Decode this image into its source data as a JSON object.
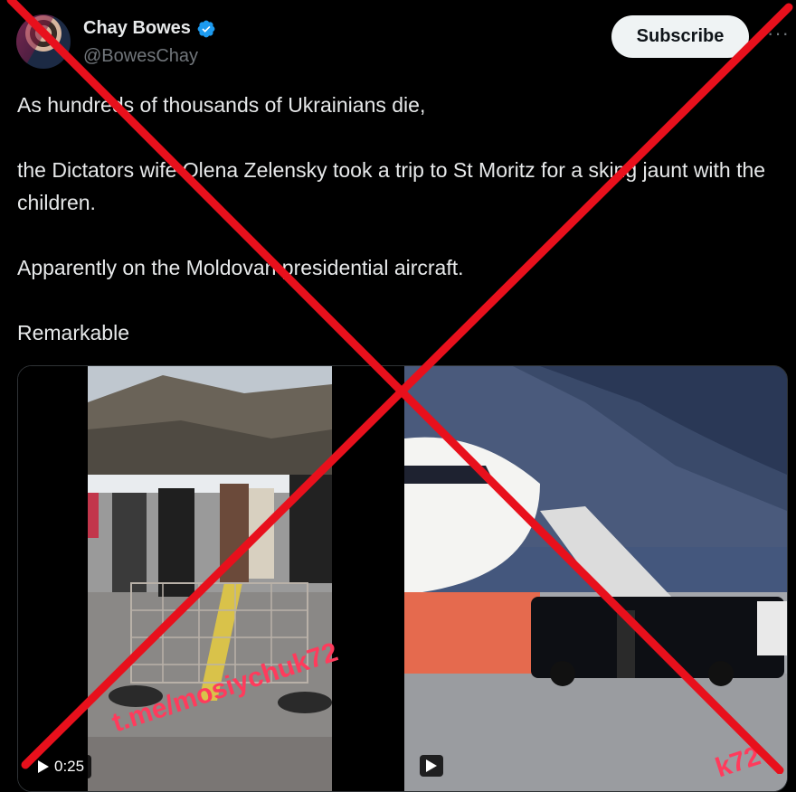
{
  "author": {
    "name": "Chay Bowes",
    "handle": "@BowesChay",
    "verified_icon": "verified-badge-icon",
    "verified_color": "#1d9bf0"
  },
  "actions": {
    "subscribe_label": "Subscribe",
    "more_label": "···"
  },
  "tweet": {
    "lines": [
      "As hundreds of thousands of Ukrainians die,",
      "the Dictators wife Olena Zelensky took a trip to St Moritz for a sking jaunt with the children.",
      "Apparently on the Moldovan presidential aircraft.",
      "Remarkable"
    ]
  },
  "media": {
    "video1": {
      "duration": "0:25",
      "watermark": "t.me/mosiychuk72"
    },
    "video2": {
      "watermark": "k72"
    }
  },
  "overlay": {
    "cross_color": "#e8101c"
  }
}
